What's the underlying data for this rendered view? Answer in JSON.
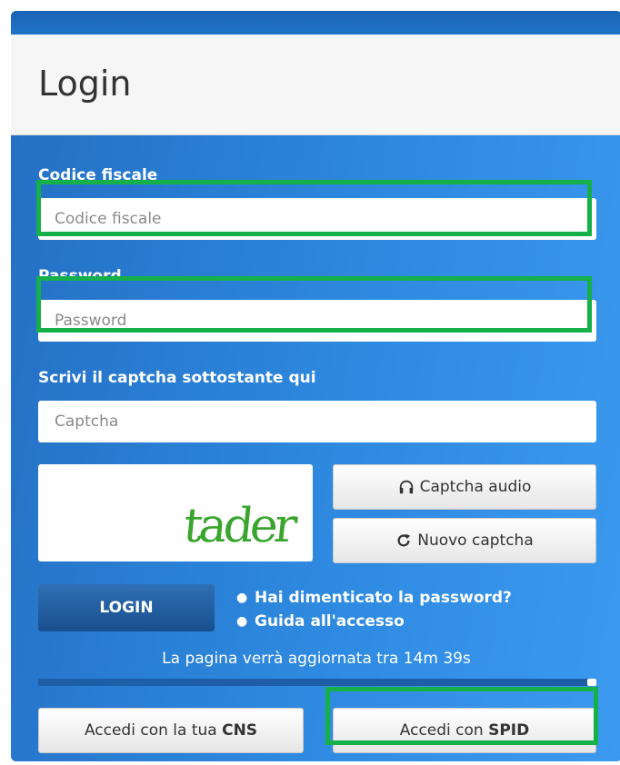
{
  "header": {
    "title": "Login"
  },
  "form": {
    "codice_fiscale_label": "Codice fiscale",
    "codice_fiscale_placeholder": "Codice fiscale",
    "password_label": "Password",
    "password_placeholder": "Password",
    "captcha_label": "Scrivi il captcha sottostante qui",
    "captcha_placeholder": "Captcha",
    "captcha_image_text": "tader",
    "captcha_audio_label": "Captcha audio",
    "nuovo_captcha_label": "Nuovo captcha",
    "login_button": "LOGIN"
  },
  "links": {
    "forgot_password": "Hai dimenticato la password?",
    "guide": "Guida all'accesso"
  },
  "refresh_text": "La pagina verrà aggiornata tra 14m 39s",
  "access_buttons": {
    "cns_prefix": "Accedi con la tua ",
    "cns_bold": "CNS",
    "spid_prefix": "Accedi con ",
    "spid_bold": "SPID"
  },
  "colors": {
    "panel_blue": "#2a86d8",
    "login_button": "#184f8e",
    "highlight_green": "#16b04a",
    "captcha_green": "#3aa52e"
  }
}
